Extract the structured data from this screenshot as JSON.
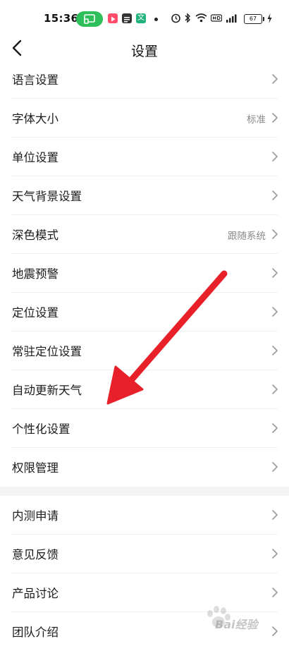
{
  "status_bar": {
    "time": "15:36",
    "battery": "67",
    "text_app_glyph": "文",
    "icons": [
      "cast-icon",
      "video-app-icon",
      "news-app-icon",
      "text-app-icon",
      "alarm-icon",
      "bluetooth-icon",
      "wifi-icon",
      "hd-icon",
      "signal-5g-icon",
      "battery-icon",
      "charging-icon"
    ]
  },
  "header": {
    "title": "设置",
    "back_icon": "chevron-left-icon"
  },
  "settings_group_1": [
    {
      "label": "语言设置",
      "value": ""
    },
    {
      "label": "字体大小",
      "value": "标准"
    },
    {
      "label": "单位设置",
      "value": ""
    },
    {
      "label": "天气背景设置",
      "value": ""
    },
    {
      "label": "深色模式",
      "value": "跟随系统"
    },
    {
      "label": "地震预警",
      "value": ""
    },
    {
      "label": "定位设置",
      "value": ""
    },
    {
      "label": "常驻定位设置",
      "value": ""
    },
    {
      "label": "自动更新天气",
      "value": ""
    },
    {
      "label": "个性化设置",
      "value": ""
    },
    {
      "label": "权限管理",
      "value": ""
    }
  ],
  "settings_group_2": [
    {
      "label": "内测申请",
      "value": ""
    },
    {
      "label": "意见反馈",
      "value": ""
    },
    {
      "label": "产品讨论",
      "value": ""
    },
    {
      "label": "团队介绍",
      "value": ""
    }
  ],
  "watermark": {
    "text": "Bai经验"
  },
  "colors": {
    "annotation_arrow": "#e8202a",
    "cast_pill": "#2fbf5a",
    "group_gap": "#f4f4f4",
    "secondary_text": "#8a8a8a"
  }
}
